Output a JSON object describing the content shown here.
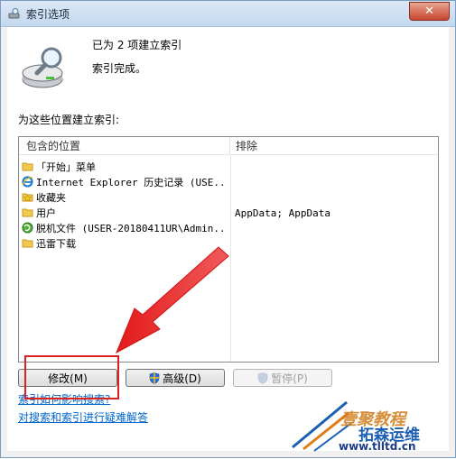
{
  "window": {
    "title": "索引选项",
    "close_symbol": "✕"
  },
  "status": {
    "line1": "已为 2 项建立索引",
    "line2": "索引完成。"
  },
  "section_label": "为这些位置建立索引:",
  "table": {
    "columns": [
      "包含的位置",
      "排除"
    ],
    "rows": [
      {
        "icon": "folder-icon",
        "location": "「开始」菜单",
        "exclude": ""
      },
      {
        "icon": "ie-icon",
        "location": "Internet Explorer 历史记录 (USE...",
        "exclude": ""
      },
      {
        "icon": "favorites-star-icon",
        "location": "收藏夹",
        "exclude": ""
      },
      {
        "icon": "folder-icon",
        "location": "用户",
        "exclude": "AppData; AppData"
      },
      {
        "icon": "offline-files-icon",
        "location": "脱机文件 (USER-20180411UR\\Admin...",
        "exclude": ""
      },
      {
        "icon": "folder-icon",
        "location": "迅雷下载",
        "exclude": ""
      }
    ]
  },
  "buttons": {
    "modify": "修改(M)",
    "advanced": "高级(D)",
    "pause": "暂停(P)"
  },
  "links": {
    "how_affects": "索引如何影响搜索?",
    "troubleshoot": "对搜索和索引进行疑难解答"
  },
  "watermark": {
    "line1": "壹聚教程",
    "line2": "拓森运维",
    "line3": "www.tlltd.cn"
  },
  "colors": {
    "link": "#0066cc",
    "highlight_box": "#e02020",
    "arrow": "#e02020"
  }
}
